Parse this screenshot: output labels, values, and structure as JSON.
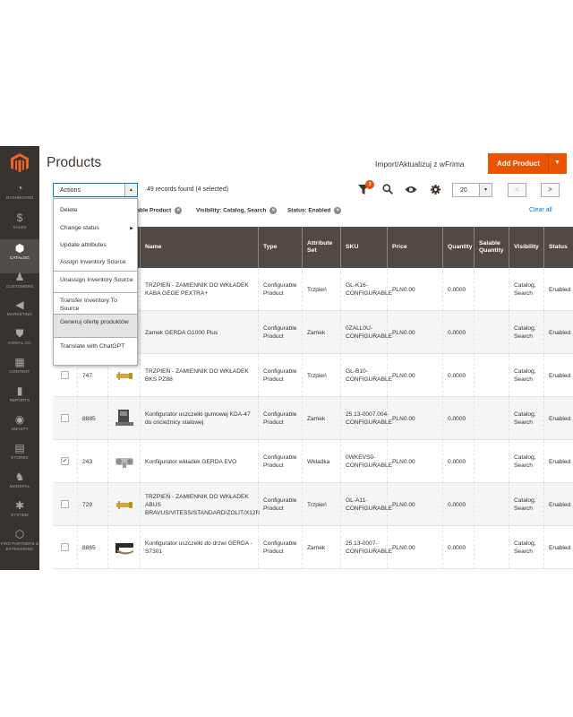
{
  "sidebar": {
    "items": [
      {
        "label": "DASHBOARD",
        "icon": "dashboard-icon",
        "glyph": "◔"
      },
      {
        "label": "SALES",
        "icon": "dollar-icon",
        "glyph": "$"
      },
      {
        "label": "CATALOG",
        "icon": "cube-icon",
        "glyph": "⬢",
        "active": true
      },
      {
        "label": "CUSTOMERS",
        "icon": "person-icon",
        "glyph": "♟"
      },
      {
        "label": "MARKETING",
        "icon": "megaphone-icon",
        "glyph": "◀"
      },
      {
        "label": "KOWAL.CO",
        "icon": "shield-icon",
        "glyph": "⛊"
      },
      {
        "label": "CONTENT",
        "icon": "content-icon",
        "glyph": "▦"
      },
      {
        "label": "REPORTS",
        "icon": "bar-chart-icon",
        "glyph": "▮"
      },
      {
        "label": "AMASTY",
        "icon": "amasty-icon",
        "glyph": "◉"
      },
      {
        "label": "STORES",
        "icon": "store-icon",
        "glyph": "▤"
      },
      {
        "label": "MAGEPAL",
        "icon": "horse-icon",
        "glyph": "♞"
      },
      {
        "label": "SYSTEM",
        "icon": "gear-icon",
        "glyph": "✱"
      },
      {
        "label": "FIND PARTNERS & EXTENSIONS",
        "icon": "partners-icon",
        "glyph": "⬡"
      }
    ]
  },
  "header": {
    "title": "Products",
    "import_link": "Import/Aktualizuj z wFrima",
    "add_product": "Add Product"
  },
  "toolbar": {
    "actions_label": "Actions",
    "records": "49 records found (4 selected)",
    "filter_count": "3",
    "per_page": "20",
    "prev": "<",
    "next": ">"
  },
  "filters": {
    "chips": [
      "rable Product",
      "Visibility: Catalog, Search",
      "Status: Enabled"
    ],
    "clear_all": "Clear all"
  },
  "actions_menu": [
    "Delete",
    "Change status",
    "Update attributes",
    "Assign Inventory Source",
    "Unassign Inventory Source",
    "Transfer Inventory To Source",
    "Generuj ofertę produktów",
    "Translate with ChatGPT"
  ],
  "grid": {
    "columns": [
      "Name",
      "Type",
      "Attribute Set",
      "SKU",
      "Price",
      "Quantity",
      "Salable Quantity",
      "Visibility",
      "Status"
    ],
    "rows": [
      {
        "checked": false,
        "id": "",
        "thumb": "key-insert",
        "name": "TRZPIEŃ - ZAMIENNIK DO WKŁADEK KABA GEGE PEXTRA+",
        "type": "Configurable Product",
        "attr": "Trzpień",
        "sku": "GL-K16-CONFIGURABLE",
        "price": "PLN0.00",
        "qty": "0.0000",
        "visibility": "Catalog, Search",
        "status": "Enabled"
      },
      {
        "checked": false,
        "id": "",
        "thumb": "key-insert",
        "name": "Zamek GERDA G1000 Plus",
        "type": "Configurable Product",
        "attr": "Zamek",
        "sku": "0ZALL0U-CONFIGURABLE",
        "price": "PLN0.00",
        "qty": "0.0000",
        "visibility": "Catalog, Search",
        "status": "Enabled"
      },
      {
        "checked": false,
        "id": "747",
        "thumb": "key-insert",
        "name": "TRZPIEŃ - ZAMIENNIK DO WKŁADEK BKS PZ88",
        "type": "Configurable Product",
        "attr": "Trzpień",
        "sku": "GL-B10-CONFIGURABLE",
        "price": "PLN0.00",
        "qty": "0.0000",
        "visibility": "Catalog, Search",
        "status": "Enabled"
      },
      {
        "checked": false,
        "id": "8885",
        "thumb": "strike-plate",
        "name": "Konfigurator uszczelki gumowej KDA-47 do ościeżnicy stalowej",
        "type": "Configurable Product",
        "attr": "Zamek",
        "sku": "25.13-0007.004-CONFIGURABLE",
        "price": "PLN0.00",
        "qty": "0.0000",
        "visibility": "Catalog, Search",
        "status": "Enabled"
      },
      {
        "checked": true,
        "id": "243",
        "thumb": "cylinder",
        "name": "Konfigurator wkładek GERDA EVO",
        "type": "Configurable Product",
        "attr": "Wkładka",
        "sku": "0WKEVS0-CONFIGURABLE",
        "price": "PLN0.00",
        "qty": "0.0000",
        "visibility": "Catalog, Search",
        "status": "Enabled"
      },
      {
        "checked": false,
        "id": "729",
        "thumb": "key-insert",
        "name": "TRZPIEŃ - ZAMIENNIK DO WKŁADEK ABUS BRAVUS/VITESS/STANDARD/ZOLIT/X12R",
        "type": "Configurable Product",
        "attr": "Trzpień",
        "sku": "GL-A11-CONFIGURABLE",
        "price": "PLN0.00",
        "qty": "0.0000",
        "visibility": "Catalog, Search",
        "status": "Enabled"
      },
      {
        "checked": false,
        "id": "8865",
        "thumb": "seal",
        "name": "Konfigurator uszczelki do drzwi GERDA - S7301",
        "type": "Configurable Product",
        "attr": "Zamek",
        "sku": "25.13-0007-CONFIGURABLE",
        "price": "PLN0.00",
        "qty": "0.0000",
        "visibility": "Catalog, Search",
        "status": "Enabled"
      }
    ]
  },
  "colors": {
    "sidebar_bg": "#373330",
    "accent": "#eb5202",
    "grid_header": "#514943",
    "link": "#007bdb"
  }
}
